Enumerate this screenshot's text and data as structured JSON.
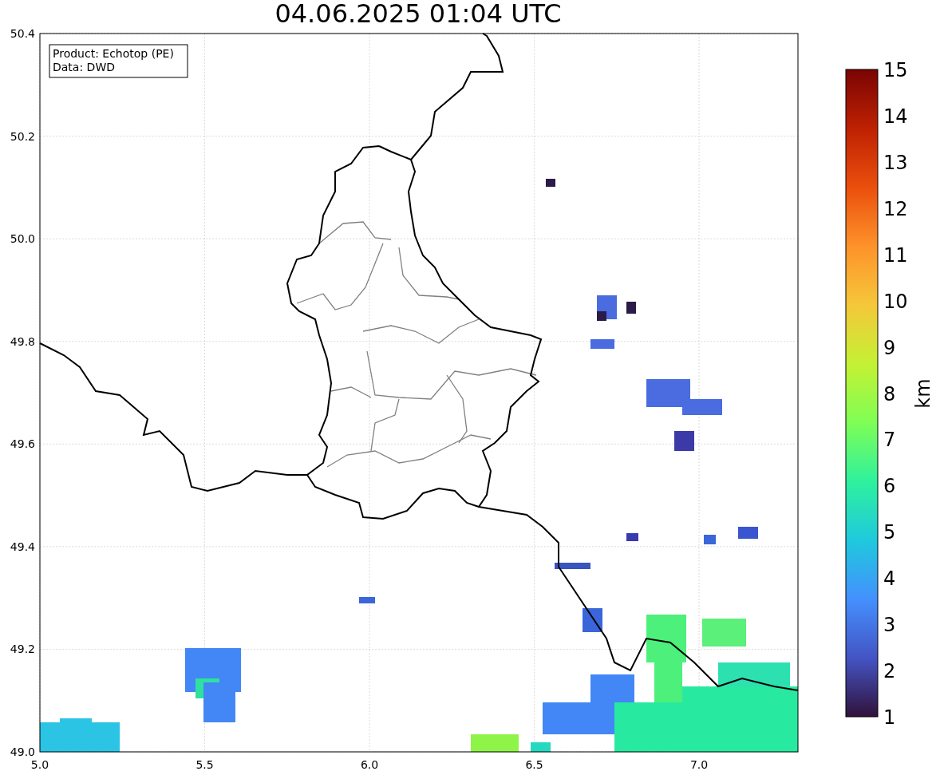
{
  "title": "04.06.2025 01:04 UTC",
  "info_box": [
    "Product: Echotop (PE)",
    "Data: DWD"
  ],
  "x_ticks": [
    "5.0",
    "5.5",
    "6.0",
    "6.5",
    "7.0"
  ],
  "y_ticks": [
    "50.4",
    "50.2",
    "50.0",
    "49.8",
    "49.6",
    "49.4",
    "49.2",
    "49.0"
  ],
  "colorbar": {
    "label": "km",
    "ticks": [
      "15",
      "14",
      "13",
      "12",
      "11",
      "10",
      "9",
      "8",
      "7",
      "6",
      "5",
      "4",
      "3",
      "2",
      "1"
    ]
  }
}
